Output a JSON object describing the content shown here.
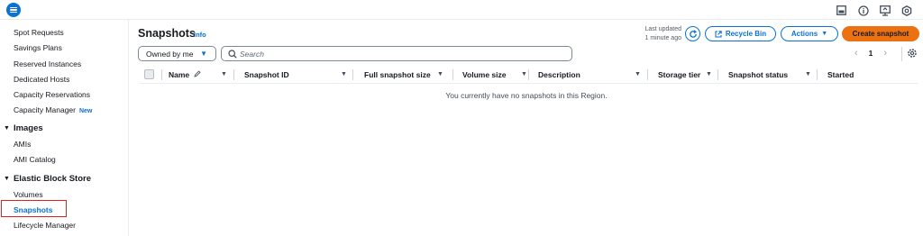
{
  "sidebar": {
    "items_top": [
      {
        "label": "Spot Requests"
      },
      {
        "label": "Savings Plans"
      },
      {
        "label": "Reserved Instances"
      },
      {
        "label": "Dedicated Hosts"
      },
      {
        "label": "Capacity Reservations"
      },
      {
        "label": "Capacity Manager",
        "badge": "New"
      }
    ],
    "images": {
      "title": "Images",
      "items": [
        "AMIs",
        "AMI Catalog"
      ]
    },
    "ebs": {
      "title": "Elastic Block Store",
      "items": [
        "Volumes",
        "Snapshots",
        "Lifecycle Manager"
      ]
    }
  },
  "header": {
    "title": "Snapshots",
    "info": "Info",
    "last_updated_line1": "Last updated",
    "last_updated_line2": "1 minute ago",
    "recycle_bin": "Recycle Bin",
    "actions": "Actions",
    "create": "Create snapshot"
  },
  "filter": {
    "owned": "Owned by me",
    "search_placeholder": "Search"
  },
  "pagination": {
    "page": "1"
  },
  "table": {
    "columns": [
      "Name",
      "Snapshot ID",
      "Full snapshot size",
      "Volume size",
      "Description",
      "Storage tier",
      "Snapshot status",
      "Started"
    ],
    "empty_message": "You currently have no snapshots in this Region."
  },
  "colors": {
    "accent": "#0972d3",
    "primary_button": "#ec7211",
    "highlight": "#e02020"
  }
}
